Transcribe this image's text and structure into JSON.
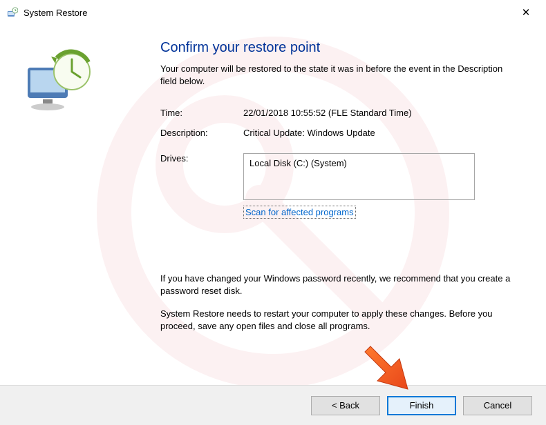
{
  "window": {
    "title": "System Restore",
    "close_symbol": "✕"
  },
  "main": {
    "heading": "Confirm your restore point",
    "intro": "Your computer will be restored to the state it was in before the event in the Description field below.",
    "fields": {
      "time_label": "Time:",
      "time_value": "22/01/2018 10:55:52 (FLE Standard Time)",
      "desc_label": "Description:",
      "desc_value": "Critical Update: Windows Update",
      "drives_label": "Drives:",
      "drives_value": "Local Disk (C:) (System)"
    },
    "scan_link": "Scan for affected programs",
    "note1": "If you have changed your Windows password recently, we recommend that you create a password reset disk.",
    "note2": "System Restore needs to restart your computer to apply these changes. Before you proceed, save any open files and close all programs."
  },
  "footer": {
    "back": "< Back",
    "finish": "Finish",
    "cancel": "Cancel"
  }
}
